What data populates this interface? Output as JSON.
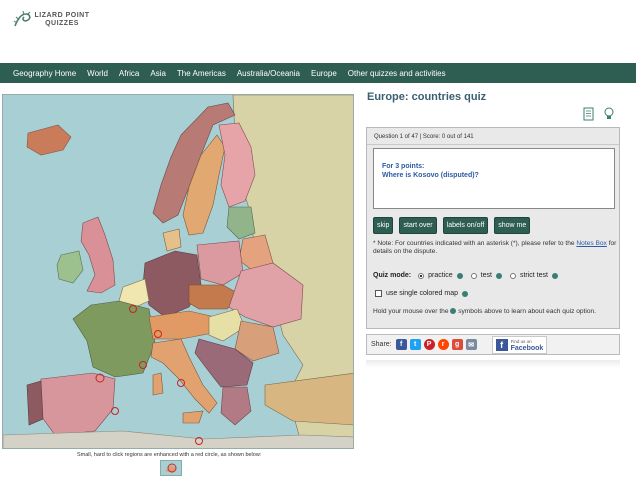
{
  "brand": {
    "line1": "Lizard Point",
    "line2": "Quizzes"
  },
  "nav": [
    "Geography Home",
    "World",
    "Africa",
    "Asia",
    "The Americas",
    "Australia/Oceania",
    "Europe",
    "Other quizzes and activities"
  ],
  "map": {
    "note": "Small, hard to click regions are enhanced with a red circle, as shown below:"
  },
  "quiz": {
    "title": "Europe: countries quiz",
    "status": "Question 1 of 47 | Score: 0 out of 141",
    "points": "For 3 points:",
    "question": "Where is Kosovo (disputed)?",
    "buttons": [
      "skip",
      "start over",
      "labels on/off",
      "show me"
    ],
    "note_prefix": "* Note: For countries indicated with an asterisk (*), please refer to the",
    "note_link": "Notes Box",
    "note_suffix": "for details on the dispute.",
    "mode_label": "Quiz mode:",
    "modes": [
      "practice",
      "test",
      "strict test"
    ],
    "single_color": "use single colored map",
    "hover_note_a": "Hold your mouse over the",
    "hover_note_b": "symbols above to learn about each quiz option."
  },
  "share": {
    "label": "Share:",
    "icons": [
      "facebook-icon",
      "twitter-icon",
      "pinterest-icon",
      "reddit-icon",
      "google-plus-icon",
      "email-icon"
    ],
    "fb_small": "Find us on",
    "fb_big": "Facebook"
  },
  "colors": {
    "nav_bg": "#2e5d52",
    "sea": "#a8cfd3",
    "title": "#3a5f72",
    "question": "#2d5aa2"
  }
}
